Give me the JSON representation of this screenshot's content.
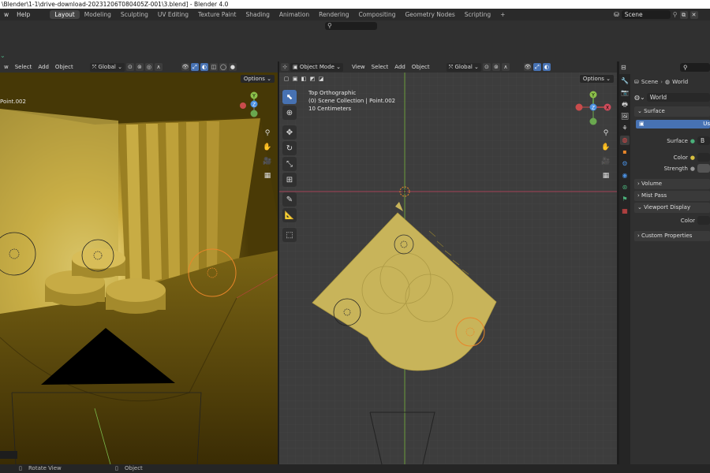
{
  "window": {
    "title": "\\Blender\\1-1\\drive-download-20231206T080405Z-001\\3.blend] - Blender 4.0"
  },
  "menu": {
    "items": [
      "w",
      "Help"
    ]
  },
  "workspaces": [
    "Layout",
    "Modeling",
    "Sculpting",
    "UV Editing",
    "Texture Paint",
    "Shading",
    "Animation",
    "Rendering",
    "Compositing",
    "Geometry Nodes",
    "Scripting",
    "+"
  ],
  "active_workspace": "Layout",
  "scene": {
    "name": "Scene"
  },
  "viewport_left": {
    "header": {
      "menu": [
        "w",
        "Select",
        "Add",
        "Object"
      ],
      "orientation": "Global",
      "options": "Options"
    },
    "overlay": {
      "object": "Point.002"
    }
  },
  "viewport_right": {
    "header": {
      "mode": "Object Mode",
      "menu": [
        "View",
        "Select",
        "Add",
        "Object"
      ],
      "orientation": "Global",
      "options": "Options"
    },
    "overlay": {
      "line1": "Top Orthographic",
      "line2": "(0) Scene Collection | Point.002",
      "line3": "10 Centimeters"
    }
  },
  "gizmo": {
    "x": "X",
    "y": "Y",
    "z": "Z"
  },
  "properties": {
    "breadcrumb": {
      "scene": "Scene",
      "world": "World"
    },
    "world_name": "World",
    "surface_header": "Surface",
    "use_nodes_btn": "Us",
    "surface_label": "Surface",
    "surface_val": "B",
    "color_label": "Color",
    "strength_label": "Strength",
    "panels": [
      "Volume",
      "Mist Pass",
      "Viewport Display"
    ],
    "vp_color_label": "Color",
    "custom_props": "Custom Properties"
  },
  "status": {
    "left": "Rotate View",
    "right": "Object"
  },
  "colors": {
    "accent": "#4772b3",
    "mesh": "#c8b45a",
    "light": "#e8862a"
  }
}
